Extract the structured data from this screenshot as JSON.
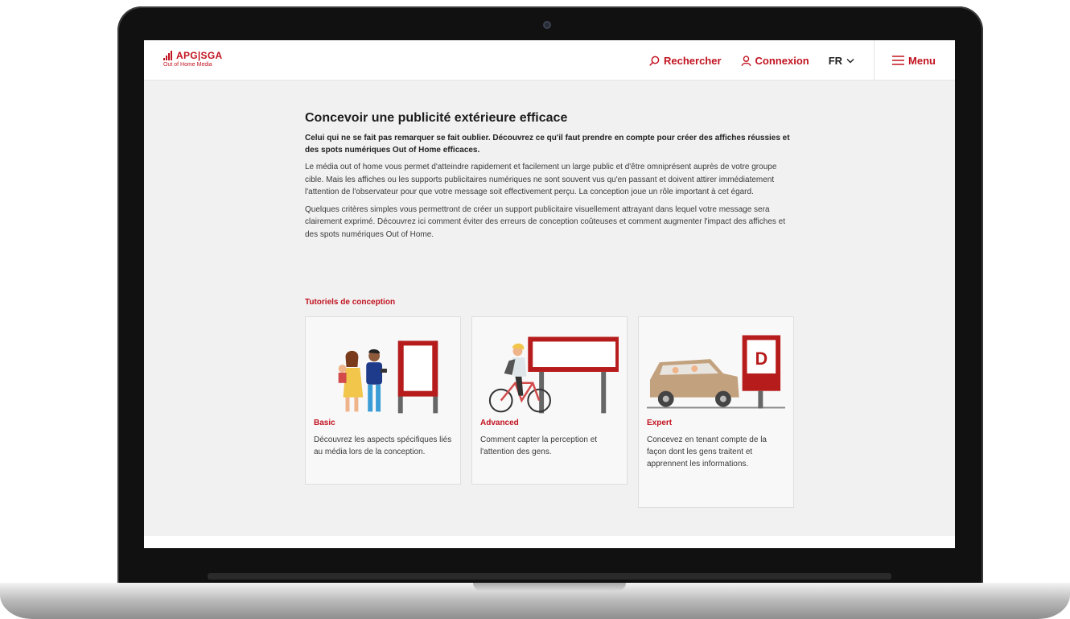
{
  "header": {
    "logo_text": "APG|SGA",
    "logo_sub": "Out of Home Media",
    "search_label": "Rechercher",
    "login_label": "Connexion",
    "language": "FR",
    "menu_label": "Menu"
  },
  "article": {
    "title": "Concevoir une publicité extérieure efficace",
    "lead": "Celui qui ne se fait pas remarquer se fait oublier. Découvrez ce qu'il faut prendre en compte pour créer des affiches réussies et des spots numériques Out of Home efficaces.",
    "paragraph_1": "Le média out of home vous permet d'atteindre rapidement et facilement un large public et d'être omniprésent auprès de votre groupe cible. Mais les affiches ou les supports publicitaires numériques ne sont souvent vus qu'en passant et doivent attirer immédiatement l'attention de l'observateur pour que votre message soit effectivement perçu. La conception joue un rôle important à cet égard.",
    "paragraph_2": "Quelques critères simples vous permettront de créer un support publicitaire visuellement attrayant dans lequel votre message sera clairement exprimé. Découvrez ici comment éviter des erreurs de conception coûteuses et comment augmenter l'impact des affiches et des spots numériques Out of Home."
  },
  "tutorials": {
    "section_title": "Tutoriels de conception",
    "cards": [
      {
        "title": "Basic",
        "text": "Découvrez les aspects spécifiques liés au média lors de la conception.",
        "illustration": "family-poster-illustration"
      },
      {
        "title": "Advanced",
        "text": "Comment capter la perception et l'attention des gens.",
        "illustration": "cyclist-billboard-illustration"
      },
      {
        "title": "Expert",
        "text": "Concevez en tenant compte de la façon dont les gens traitent et apprennent les informations.",
        "illustration": "car-poster-illustration",
        "poster_letter": "D"
      }
    ]
  },
  "colors": {
    "brand_red": "#c1121f",
    "page_bg": "#f1f1f1",
    "card_bg": "#f8f8f8"
  }
}
